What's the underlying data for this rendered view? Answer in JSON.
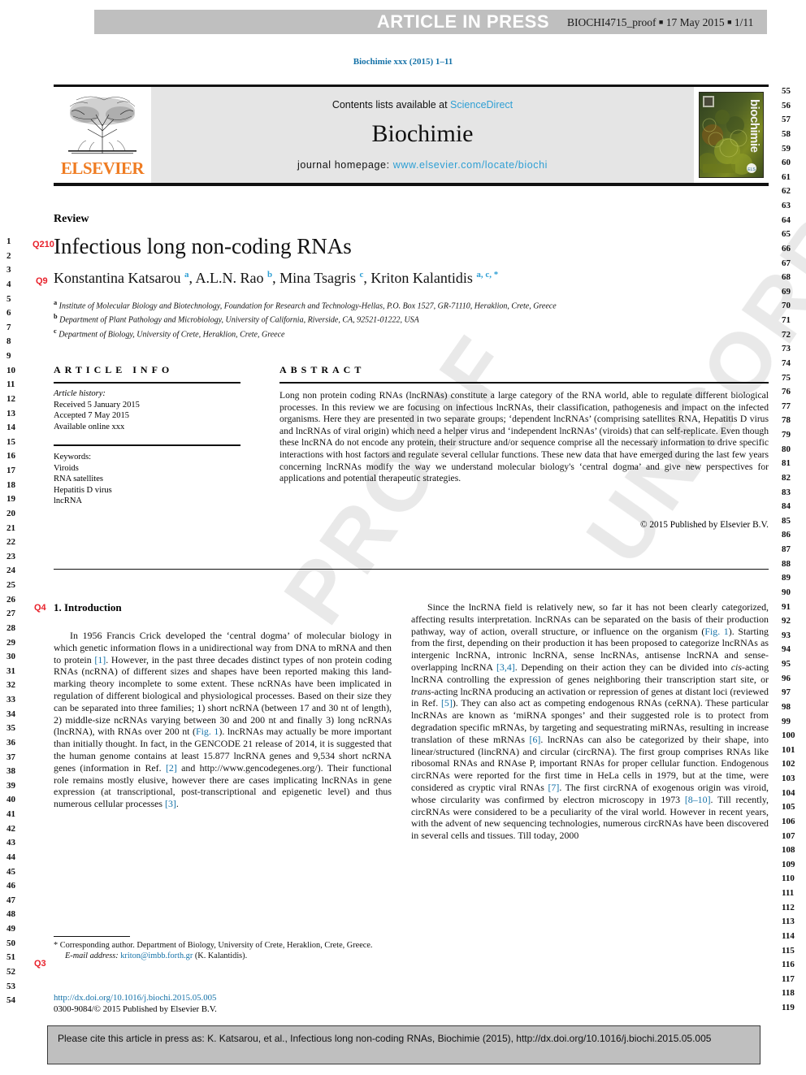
{
  "header": {
    "press_banner": "ARTICLE IN PRESS",
    "proof_id": "BIOCHI4715_proof",
    "proof_date": "17 May 2015",
    "proof_page": "1/11",
    "journal_ref": "Biochimie xxx (2015) 1–11"
  },
  "masthead": {
    "contents_prefix": "Contents lists available at ",
    "contents_link": "ScienceDirect",
    "journal_title": "Biochimie",
    "homepage_prefix": "journal homepage: ",
    "homepage_url": "www.elsevier.com/locate/biochi",
    "publisher": "ELSEVIER",
    "cover_label": "biochimie"
  },
  "article": {
    "type": "Review",
    "title": "Infectious long non-coding RNAs",
    "authors_html": "Konstantina Katsarou <sup>a</sup>, A.L.N. Rao <sup>b</sup>, Mina Tsagris <sup>c</sup>, Kriton Kalantidis <sup>a, c, *</sup>",
    "affiliations": [
      "Institute of Molecular Biology and Biotechnology, Foundation for Research and Technology-Hellas, P.O. Box 1527, GR-71110, Heraklion, Crete, Greece",
      "Department of Plant Pathology and Microbiology, University of California, Riverside, CA, 92521-01222, USA",
      "Department of Biology, University of Crete, Heraklion, Crete, Greece"
    ],
    "affiliation_marks": [
      "a",
      "b",
      "c"
    ]
  },
  "query_marks": [
    {
      "id": "Q210",
      "label": "Q210"
    },
    {
      "id": "Q9",
      "label": "Q9"
    },
    {
      "id": "Q4",
      "label": "Q4"
    },
    {
      "id": "Q3",
      "label": "Q3"
    }
  ],
  "info": {
    "heading": "ARTICLE INFO",
    "history_label": "Article history:",
    "history": [
      "Received 5 January 2015",
      "Accepted 7 May 2015",
      "Available online xxx"
    ],
    "keywords_label": "Keywords:",
    "keywords": [
      "Viroids",
      "RNA satellites",
      "Hepatitis D virus",
      "lncRNA"
    ]
  },
  "abstract": {
    "heading": "ABSTRACT",
    "text": "Long non protein coding RNAs (lncRNAs) constitute a large category of the RNA world, able to regulate different biological processes. In this review we are focusing on infectious lncRNAs, their classification, pathogenesis and impact on the infected organisms. Here they are presented in two separate groups; ‘dependent lncRNAs’ (comprising satellites RNA, Hepatitis D virus and lncRNAs of viral origin) which need a helper virus and ‘independent lncRNAs’ (viroids) that can self-replicate. Even though these lncRNA do not encode any protein, their structure and/or sequence comprise all the necessary information to drive specific interactions with host factors and regulate several cellular functions. These new data that have emerged during the last few years concerning lncRNAs modify the way we understand molecular biology's ‘central dogma’ and give new perspectives for applications and potential therapeutic strategies.",
    "copyright": "© 2015 Published by Elsevier B.V."
  },
  "body": {
    "section_number": "1.",
    "section_title": "Introduction",
    "left_column_html": "In 1956 Francis Crick developed the ‘central dogma’ of molecular biology in which genetic information flows in a unidirectional way from DNA to mRNA and then to protein <span class=\"ref\">[1]</span>. However, in the past three decades distinct types of non protein coding RNAs (ncRNA) of different sizes and shapes have been reported making this land-marking theory incomplete to some extent. These ncRNAs have been implicated in regulation of different biological and physiological processes. Based on their size they can be separated into three families; 1) short ncRNA (between 17 and 30 nt of length), 2) middle-size ncRNAs varying between 30 and 200 nt and finally 3) long ncRNAs (lncRNA), with RNAs over 200 nt (<span class=\"ref\">Fig. 1</span>). lncRNAs may actually be more important than initially thought. In fact, in the GENCODE 21 release of 2014, it is suggested that the human genome contains at least 15.877 lncRNA genes and 9,534 short ncRNA genes (information in Ref. <span class=\"ref\">[2]</span> and <span class=\"link\">http://www.gencodegenes.org/</span>). Their functional role remains mostly elusive, however there are cases implicating lncRNAs in gene expression (at transcriptional, post-transcriptional and epigenetic level) and thus numerous cellular processes <span class=\"ref\">[3]</span>.",
    "right_column_html": "Since the lncRNA field is relatively new, so far it has not been clearly categorized, affecting results interpretation. lncRNAs can be separated on the basis of their production pathway, way of action, overall structure, or influence on the organism (<span class=\"ref\">Fig. 1</span>). Starting from the first, depending on their production it has been proposed to categorize lncRNAs as intergenic lncRNA, intronic lncRNA, sense lncRNAs, antisense lncRNA and sense-overlapping lncRNA <span class=\"ref\">[3,4]</span>. Depending on their action they can be divided into <i>cis</i>-acting lncRNA controlling the expression of genes neighboring their transcription start site, or <i>trans</i>-acting lncRNA producing an activation or repression of genes at distant loci (reviewed in Ref. <span class=\"ref\">[5]</span>). They can also act as competing endogenous RNAs (ceRNA). These particular lncRNAs are known as ‘miRNA sponges’ and their suggested role is to protect from degradation specific mRNAs, by targeting and sequestrating miRNAs, resulting in increase translation of these mRNAs <span class=\"ref\">[6]</span>. lncRNAs can also be categorized by their shape, into linear/structured (lincRNA) and circular (circRNA). The first group comprises RNAs like ribosomal RNAs and RNAse P, important RNAs for proper cellular function. Endogenous circRNAs were reported for the first time in HeLa cells in 1979, but at the time, were considered as cryptic viral RNAs <span class=\"ref\">[7]</span>. The first circRNA of exogenous origin was viroid, whose circularity was confirmed by electron microscopy in 1973 <span class=\"ref\">[8–10]</span>. Till recently, circRNAs were considered to be a peculiarity of the viral world. However in recent years, with the advent of new sequencing technologies, numerous circRNAs have been discovered in several cells and tissues. Till today, 2000"
  },
  "footnote": {
    "corresponding": "* Corresponding author. Department of Biology, University of Crete, Heraklion, Crete, Greece.",
    "email_label": "E-mail address:",
    "email": "kriton@imbb.forth.gr",
    "email_owner": "(K. Kalantidis).",
    "doi": "http://dx.doi.org/10.1016/j.biochi.2015.05.005",
    "issn_line": "0300-9084/© 2015 Published by Elsevier B.V."
  },
  "cite_box": {
    "text": "Please cite this article in press as: K. Katsarou, et al., Infectious long non-coding RNAs, Biochimie (2015), http://dx.doi.org/10.1016/j.biochi.2015.05.005"
  },
  "line_numbers": {
    "left_start": 1,
    "left_end": 54,
    "right_start": 55,
    "right_end": 119
  },
  "colors": {
    "link": "#1572a8",
    "accent_blue": "#2e9fd4",
    "query_red": "#e8212b",
    "elsevier_orange": "#ef7c22",
    "banner_gray": "#bfbfbf",
    "masthead_gray": "#e5e5e5"
  }
}
